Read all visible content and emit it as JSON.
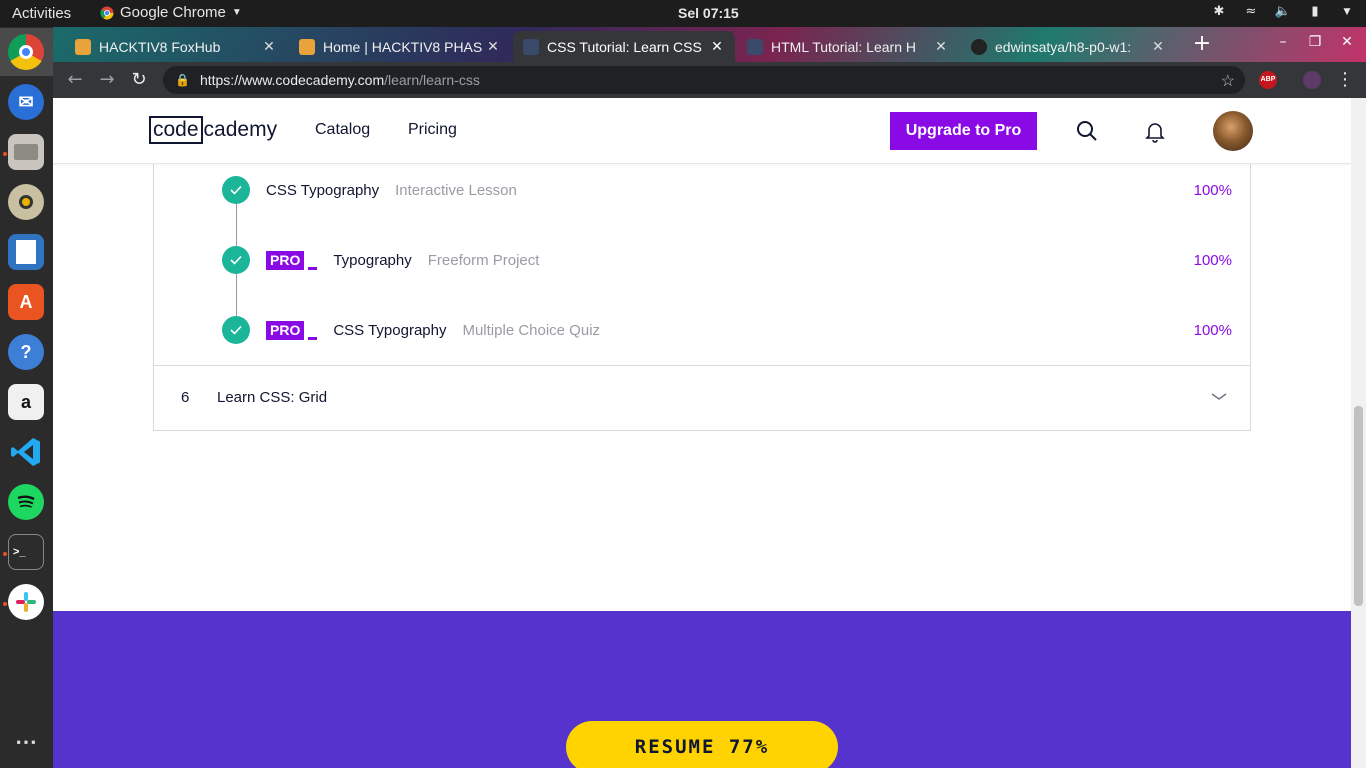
{
  "system_bar": {
    "activities": "Activities",
    "app_name": "Google Chrome",
    "clock": "Sel 07:15"
  },
  "browser": {
    "tabs": [
      {
        "title": "HACKTIV8 FoxHub",
        "favicon_color": "#e8a33c"
      },
      {
        "title": "Home | HACKTIV8 PHAS",
        "favicon_color": "#e8a33c"
      },
      {
        "title": "CSS Tutorial: Learn CSS",
        "favicon_color": "#3a4a6a",
        "active": true
      },
      {
        "title": "HTML Tutorial: Learn H",
        "favicon_color": "#3a4a6a"
      },
      {
        "title": "edwinsatya/h8-p0-w1:",
        "favicon_color": "#222222"
      }
    ],
    "url_main": "https://www.codecademy.com",
    "url_path": "/learn/learn-css",
    "ext_abp": "ABP"
  },
  "site": {
    "logo_box": "code",
    "logo_rest": "cademy",
    "nav": {
      "catalog": "Catalog",
      "pricing": "Pricing"
    },
    "upgrade_label": "Upgrade to Pro",
    "brand_color": "#8a0ae6"
  },
  "syllabus": {
    "lessons": [
      {
        "name": "CSS Typography",
        "type": "Interactive Lesson",
        "progress": "100%",
        "pro": false
      },
      {
        "name": "Typography",
        "type": "Freeform Project",
        "progress": "100%",
        "pro": true
      },
      {
        "name": "CSS Typography",
        "type": "Multiple Choice Quiz",
        "progress": "100%",
        "pro": true
      }
    ],
    "pro_badge": "PRO",
    "module": {
      "number": "6",
      "name": "Learn CSS: Grid"
    }
  },
  "footer": {
    "resume_label": "RESUME 77%",
    "band_color": "#5533cc",
    "button_color": "#ffd300"
  }
}
